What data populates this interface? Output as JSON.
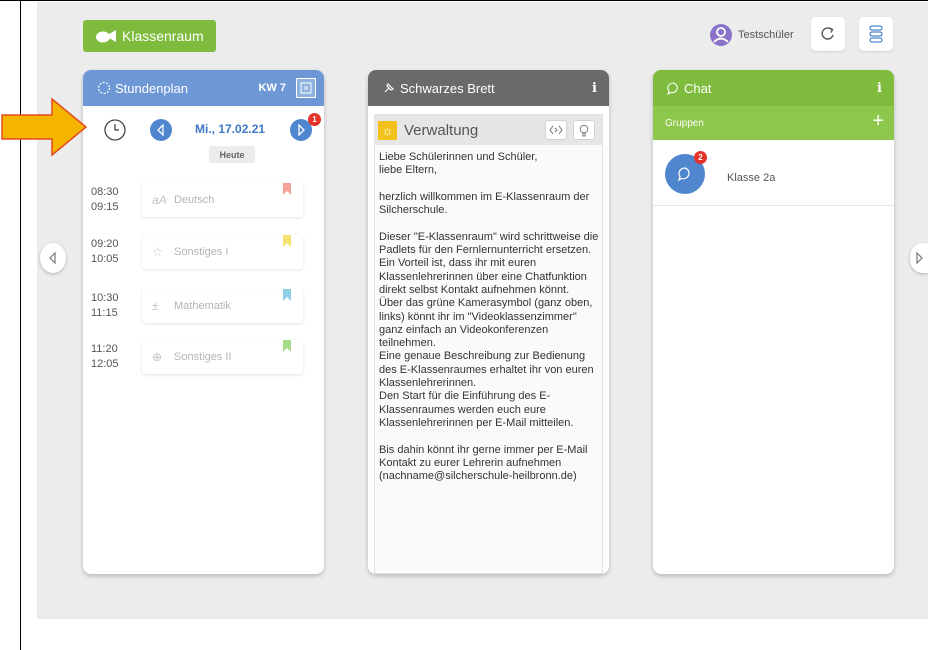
{
  "header": {
    "brand_label": "Klassenraum",
    "user_name": "Testschüler"
  },
  "stundenplan": {
    "title": "Stundenplan",
    "week_label": "KW 7",
    "date": "Mi., 17.02.21",
    "next_badge": "1",
    "today_label": "Heute",
    "lessons": [
      {
        "start": "08:30",
        "end": "09:15",
        "subject": "Deutsch",
        "icon": "aA",
        "bookmark_color": "#f4a39a"
      },
      {
        "start": "09:20",
        "end": "10:05",
        "subject": "Sonstiges I",
        "icon": "☆",
        "bookmark_color": "#f6e36f"
      },
      {
        "start": "10:30",
        "end": "11:15",
        "subject": "Mathematik",
        "icon": "±",
        "bookmark_color": "#8fd0e8"
      },
      {
        "start": "11:20",
        "end": "12:05",
        "subject": "Sonstiges II",
        "icon": "⊕",
        "bookmark_color": "#a9dc86"
      }
    ]
  },
  "brett": {
    "title": "Schwarzes Brett",
    "info": "i",
    "section_title": "Verwaltung",
    "post_text": "Liebe Schülerinnen und Schüler,\nliebe Eltern,\n\nherzlich willkommen im E-Klassenraum der Silcherschule.\n\nDieser \"E-Klassenraum\" wird schrittweise die Padlets für den Fernlernunterricht ersetzen.\nEin Vorteil ist, dass ihr mit euren Klassenlehrerinnen über eine Chatfunktion direkt selbst Kontakt aufnehmen könnt.\nÜber das grüne Kamerasymbol (ganz oben, links) könnt ihr im \"Videoklassenzimmer\" ganz einfach an Videokonferenzen teilnehmen.\nEine genaue Beschreibung zur Bedienung des E-Klassenraumes erhaltet ihr von euren Klassenlehrerinnen.\nDen Start für die Einführung des E-Klassenraumes werden euch eure Klassenlehrerinnen per E-Mail mitteilen.\n\nBis dahin könnt ihr gerne immer per E-Mail Kontakt zu eurer Lehrerin aufnehmen (nachname@silcherschule-heilbronn.de)"
  },
  "chat": {
    "title": "Chat",
    "info": "i",
    "groups_label": "Gruppen",
    "groups": [
      {
        "name": "Klasse 2a",
        "unread": "2"
      }
    ]
  },
  "colors": {
    "green": "#7fbb3c",
    "blue": "#6d98d5",
    "gray": "#6a6a6a",
    "arrow": "#f5b400"
  }
}
